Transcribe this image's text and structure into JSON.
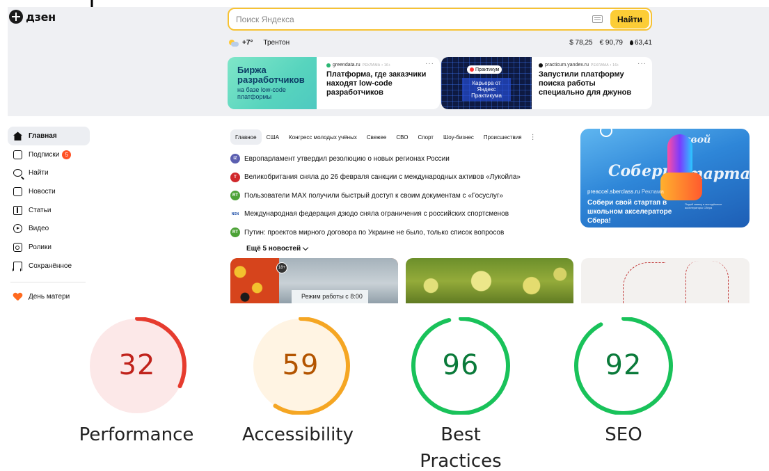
{
  "app": {
    "logo": "дзен"
  },
  "search": {
    "placeholder": "Поиск Яндекса",
    "button": "Найти"
  },
  "info": {
    "temp": "+7°",
    "city": "Трентон",
    "usd": "$ 78,25",
    "eur": "€ 90,79",
    "oil": "63,41"
  },
  "ads": [
    {
      "image_line1": "Биржа",
      "image_line2": "разработчиков",
      "image_line3": "на базе low-code",
      "image_line4": "платформы",
      "source": "greendata.ru",
      "label": "РЕКЛАМА • 16+",
      "title": "Платформа, где заказчики находят low-code разработчиков",
      "more": "···",
      "color": "#2bb673"
    },
    {
      "pill": "Практикум",
      "image_text": "Карьера от Яндекс Практикума",
      "source": "practicum.yandex.ru",
      "label": "РЕКЛАМА • 16+",
      "title": "Запустили платформу поиска работы специально для джунов",
      "more": "···",
      "color": "#111111"
    }
  ],
  "sidebar": {
    "items": [
      {
        "label": "Главная",
        "icon": "home-icon",
        "active": true
      },
      {
        "label": "Подписки",
        "icon": "subscriptions-icon",
        "badge": "5"
      },
      {
        "label": "Найти",
        "icon": "search-icon"
      },
      {
        "label": "Новости",
        "icon": "news-icon"
      },
      {
        "label": "Статьи",
        "icon": "articles-icon"
      },
      {
        "label": "Видео",
        "icon": "video-icon"
      },
      {
        "label": "Ролики",
        "icon": "clips-icon"
      },
      {
        "label": "Сохранённое",
        "icon": "bookmark-icon"
      }
    ],
    "special": {
      "label": "День матери",
      "icon": "heart-icon"
    }
  },
  "tabs": [
    "Главное",
    "США",
    "Конгресс молодых учёных",
    "Свежее",
    "СВО",
    "Спорт",
    "Шоу-бизнес",
    "Происшествия"
  ],
  "tabs_more": "⋮",
  "news": [
    {
      "text": "Европарламент утвердил резолюцию о новых регионах России",
      "src": "IZ",
      "color": "#5b5fb0"
    },
    {
      "text": "Великобритания сняла до 26 февраля санкции с международных активов «Лукойла»",
      "src": "Т",
      "color": "#d0282c"
    },
    {
      "text": "Пользователи MAX получили быстрый доступ к своим документам с «Госуслуг»",
      "src": "RT",
      "color": "#4ca236"
    },
    {
      "text": "Международная федерация дзюдо сняла ограничения с российских спортсменов",
      "src": "NSN",
      "color": "#1e4fa8"
    },
    {
      "text": "Путин: проектов мирного договора по Украине не было, только список вопросов",
      "src": "RT",
      "color": "#4ca236"
    }
  ],
  "more_news": "Ещё 5 новостей",
  "promo": {
    "source": "preaccel.sberclass.ru",
    "label": "Реклама",
    "title": "Собери свой стартап в школьном акселераторе Сбера!",
    "word1": "Собери",
    "word2": "свой",
    "word3": "стартап",
    "note": "Подай заявку в молодёжные акселераторы Сбера"
  },
  "thumbs": {
    "age": "18+",
    "sign": "Режим работы с 8:00"
  },
  "scores": [
    {
      "value": 32,
      "label": "Performance",
      "color": "#e63b2e",
      "bg": "#fce8e8",
      "text_color": "#c0221b"
    },
    {
      "value": 59,
      "label": "Accessibility",
      "color": "#f5a623",
      "bg": "#fff4e3",
      "text_color": "#b35400"
    },
    {
      "value": 96,
      "label": "Best Practices",
      "color": "#19c25a",
      "bg": "#ffffff",
      "text_color": "#0a7a3a"
    },
    {
      "value": 92,
      "label": "SEO",
      "color": "#19c25a",
      "bg": "#ffffff",
      "text_color": "#0a7a3a"
    }
  ]
}
